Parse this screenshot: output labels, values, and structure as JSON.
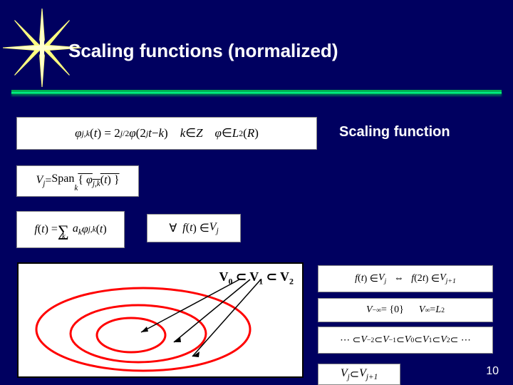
{
  "slide": {
    "title": "Scaling functions (normalized)",
    "label_scaling_function": "Scaling function",
    "page_number": "10"
  },
  "equations": {
    "phi_def_html": "<span class='ital'>φ</span><sub><span class='ital'>j,k</span></sub>(<span class='ital'>t</span>) = 2<sup><span class='ital'>j</span>/2</sup> <span class='ital'>φ</span>(2<sup><span class='ital'>j</span></sup><span class='ital'>t</span> − <span class='ital'>k</span>)&nbsp;&nbsp;&nbsp;&nbsp;<span class='ital'>k</span> ∈ <span class='ital'>Z</span>&nbsp;&nbsp;&nbsp;&nbsp;<span class='ital'>φ</span> ∈ <span class='ital'>L</span><sup>2</sup>(<span class='ital'>R</span>)",
    "span_html": "<span class='ital'>V<sub>j</sub></span> = <span class='overline'><span style='display:inline-block;transform:translateY(-2px)'>Span</span><sub style='display:inline-block;transform:translateY(6px)'><span class='ital'>k</span></sub>{ <span class='ital'>φ</span><sub><span class='ital'>j,k</span></sub>(<span class='ital'>t</span>) }</span>",
    "sum_html": "<span class='ital'>f</span>(<span class='ital'>t</span>) = <span style='font-size:1.4em;display:inline-block;transform:translateY(2px)'>∑</span><sub style='display:inline-block;transform:translate(-10px,10px)'><span class='ital'>k</span></sub> <span class='ital'>a<sub>k</sub></span> <span class='ital'>φ</span><sub><span class='ital'>j,k</span></sub>(<span class='ital'>t</span>)",
    "forall_html": "∀&nbsp;&nbsp;<span class='ital'>f</span>(<span class='ital'>t</span>) ∈ <span class='ital'>V<sub>j</sub></span>",
    "ft2t_html": "<span class='ital'>f</span>(<span class='ital'>t</span>) ∈ <span class='ital'>V<sub>j</sub></span>&nbsp;&nbsp;&nbsp;⇔&nbsp;&nbsp;&nbsp;<span class='ital'>f</span>(2<span class='ital'>t</span>) ∈ <span class='ital'>V<sub>j+1</sub></span>",
    "vinf_html": "<span class='ital'>V</span><sub>−∞</sub> = {0}&nbsp;&nbsp;&nbsp;&nbsp;&nbsp;&nbsp;<span class='ital'>V</span><sub>∞</sub> = <span class='ital'>L</span><sup>2</sup>",
    "chain_html": "⋯ ⊂ <span class='ital'>V</span><sub>−2</sub> ⊂ <span class='ital'>V</span><sub>−1</sub> ⊂ <span class='ital'>V</span><sub>0</sub> ⊂ <span class='ital'>V</span><sub>1</sub> ⊂ <span class='ital'>V</span><sub>2</sub> ⊂ ⋯",
    "subset_html": "<span class='ital'>V<sub>j</sub></span> ⊂ <span class='ital'>V<sub>j+1</sub></span>"
  },
  "diagram": {
    "nest_label_html": "V<sub>0</sub> ⊂ V<sub>1</sub> ⊂ V<sub>2</sub>"
  },
  "icons": {
    "starburst": "starburst-icon"
  }
}
